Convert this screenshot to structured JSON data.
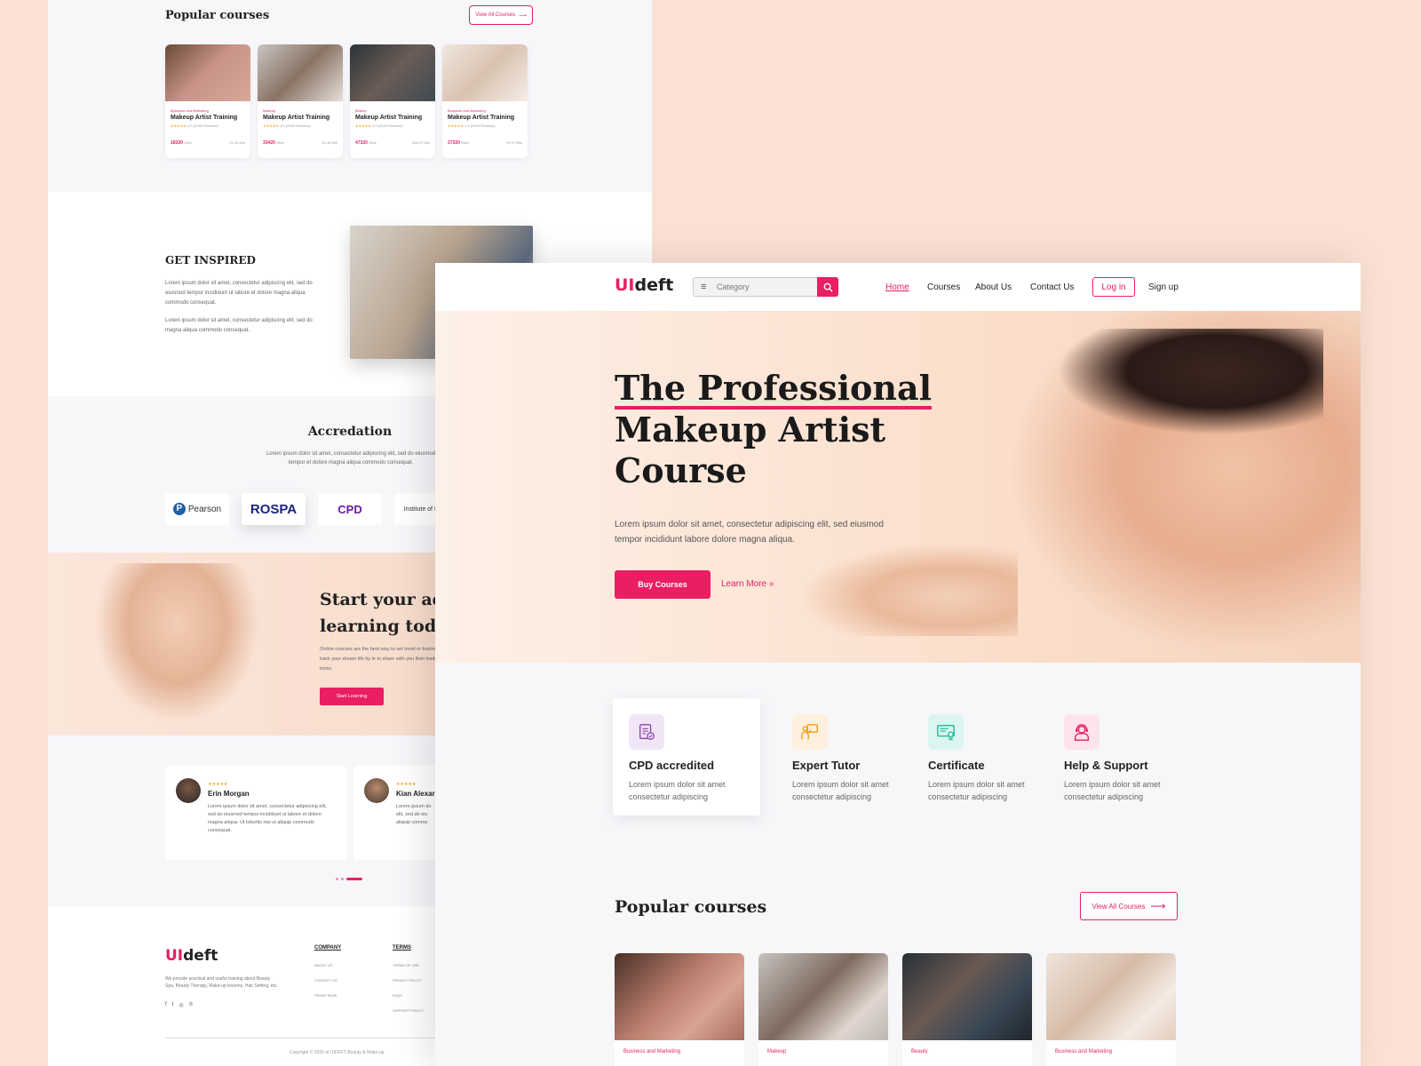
{
  "back_page": {
    "popular_title": "Popular courses",
    "view_all": "View All Courses",
    "courses": [
      {
        "category": "Business and Marketing",
        "name": "Makeup Artist Training",
        "stars": "★★★★★",
        "rating": "4.9 (2340 Reviews)",
        "views": "18320",
        "view_label": "View",
        "duration": "2h 40 Min"
      },
      {
        "category": "Makeup",
        "name": "Makeup Artist Training",
        "stars": "★★★★★",
        "rating": "4.9 (2340 Reviews)",
        "views": "33420",
        "view_label": "View",
        "duration": "3h 18 Min"
      },
      {
        "category": "Beauty",
        "name": "Makeup Artist Training",
        "stars": "★★★★★",
        "rating": "4.9 (2340 Reviews)",
        "views": "47320",
        "view_label": "View",
        "duration": "93h 47 Min"
      },
      {
        "category": "Business and Marketing",
        "name": "Makeup Artist Training",
        "stars": "★★★★★",
        "rating": "4.9 (2340 Reviews)",
        "views": "27320",
        "view_label": "View",
        "duration": "9h 07 Min"
      }
    ],
    "inspired": {
      "title": "GET INSPIRED",
      "p1": "Lorem ipsum dolor sit amet, consectetur adipiscing elit, sed do eiusmod tempor incididunt ut labore et dolore magna aliqua commodo consequat.",
      "p2": "Lorem ipsum dolor sit amet, consectetur adipiscing elit, sed do magna aliqua commodo consequat."
    },
    "accreditation": {
      "title": "Accredation",
      "desc": "Lorem ipsum dolor sit amet, consectetur adipiscing elit, sed do eiusmod tempor et dolore magna aliqua commodo consequat.",
      "logos": [
        "Pearson",
        "ROSPA",
        "CPD",
        "Institute of Hosp"
      ]
    },
    "start": {
      "title_line1": "Start your adv",
      "title_line2": "learning toda",
      "desc": "Online courses are the best way to set trend or business. Fast-track your dream life by le to share with you their trade tips and tricks.",
      "button": "Start Learning"
    },
    "reviews": [
      {
        "stars": "★★★★★",
        "name": "Erin Morgan",
        "text": "Lorem ipsum dolor sit amet, consectetur adipiscing elit, sed do eiusmod tempor incididunt ut labore et dolore magna aliqua. Ut lobortis nisi ut aliquip commodo consequat."
      },
      {
        "stars": "★★★★★",
        "name": "Kian Alexar",
        "text": "Lorem ipsum do elit, sed do eiu aliquip commo"
      }
    ],
    "footer": {
      "logo_ui": "UI",
      "logo_rest": "deft",
      "about": "We provide practical and useful training about Beauty Spa, Beauty Therapy, Make-up lessons, Hair Setting, etc.",
      "company_title": "COMPANY",
      "company_links": [
        "ABOUT US",
        "CONTACT US",
        "FRONT PAGE"
      ],
      "terms_title": "TERMS",
      "terms_links": [
        "TERMS OF USE",
        "PRIVACY POLICY",
        "FAQS",
        "SUPPORT POLICY"
      ],
      "copyright": "Copyright © 2020 at UIDEFT Beauty & Make-up"
    }
  },
  "front_page": {
    "logo_ui": "UI",
    "logo_rest": "deft",
    "search_placeholder": "Category",
    "nav": {
      "home": "Home",
      "courses": "Courses",
      "about": "About Us",
      "contact": "Contact Us",
      "login": "Log in",
      "signup": "Sign up"
    },
    "hero": {
      "title_line1": "The Professional",
      "title_line2": "Makeup Artist",
      "title_line3": "Course",
      "desc": "Lorem ipsum dolor sit amet, consectetur adipiscing elit, sed eiusmod tempor incididunt labore dolore magna aliqua.",
      "buy": "Buy Courses",
      "learn": "Learn More »"
    },
    "features": [
      {
        "icon": "document-check-icon",
        "title": "CPD accredited",
        "desc": "Lorem ipsum dolor sit amet consectetur adipiscing",
        "color": "#8e44ad",
        "bg": "#f1e6f7"
      },
      {
        "icon": "tutor-board-icon",
        "title": "Expert Tutor",
        "desc": "Lorem ipsum dolor sit amet consectetur adipiscing",
        "color": "#f39c12",
        "bg": "#fdf0de"
      },
      {
        "icon": "certificate-icon",
        "title": "Certificate",
        "desc": "Lorem ipsum dolor sit amet consectetur adipiscing",
        "color": "#1abc9c",
        "bg": "#dcf5f0"
      },
      {
        "icon": "support-agent-icon",
        "title": "Help & Support",
        "desc": "Lorem ipsum dolor sit amet consectetur adipiscing",
        "color": "#e91e63",
        "bg": "#fde3ea"
      }
    ],
    "popular_title": "Popular courses",
    "view_all": "View All Courses",
    "courses": [
      {
        "category": "Business and Marketing"
      },
      {
        "category": "Makeup"
      },
      {
        "category": "Beauty"
      },
      {
        "category": "Business and Marketing"
      }
    ]
  },
  "colors": {
    "accent": "#e91e63",
    "background": "#fbe1d3",
    "star": "#f5a623"
  }
}
